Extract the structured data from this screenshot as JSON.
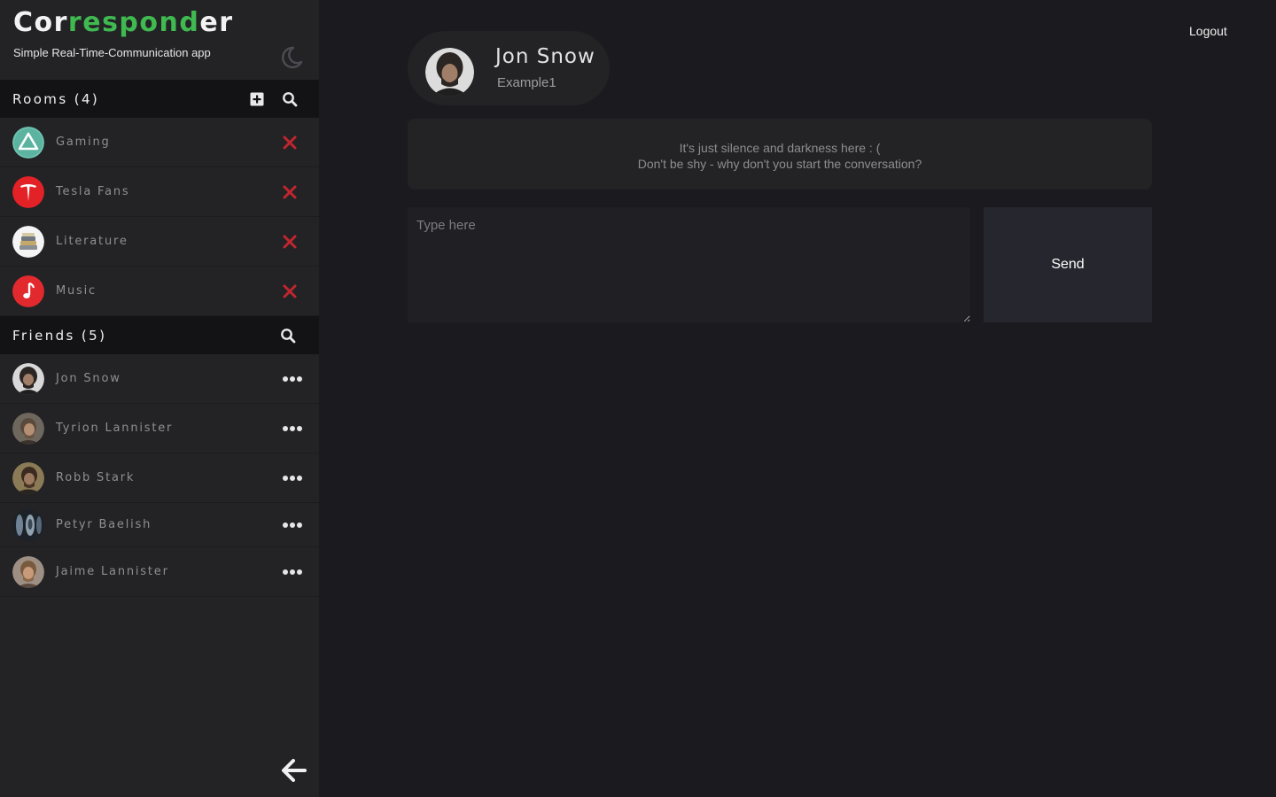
{
  "brand": {
    "title_prefix": "Cor",
    "title_accent": "respond",
    "title_suffix": "er",
    "subtitle": "Simple Real-Time-Communication app"
  },
  "rooms": {
    "title": "Rooms (4)",
    "items": [
      {
        "label": "Gaming",
        "icon": "triangle-icon"
      },
      {
        "label": "Tesla Fans",
        "icon": "tesla-logo-icon"
      },
      {
        "label": "Literature",
        "icon": "books-icon"
      },
      {
        "label": "Music",
        "icon": "music-note-icon"
      }
    ]
  },
  "friends": {
    "title": "Friends (5)",
    "items": [
      {
        "label": "Jon Snow"
      },
      {
        "label": "Tyrion Lannister"
      },
      {
        "label": "Robb Stark"
      },
      {
        "label": "Petyr Baelish"
      },
      {
        "label": "Jaime Lannister"
      }
    ]
  },
  "header": {
    "logout_label": "Logout"
  },
  "chat": {
    "contact_name": "Jon Snow",
    "contact_sub": "Example1",
    "empty_line1": "It's just silence and darkness here : (",
    "empty_line2": "Don't be shy - why don't you start the conversation?",
    "input_placeholder": "Type here",
    "send_label": "Send"
  },
  "colors": {
    "background": "#1b1b1f",
    "sidebar": "#232326",
    "section_header": "#131316",
    "accent": "#3fb950",
    "delete": "#c0262d",
    "send_button": "#26262f"
  }
}
